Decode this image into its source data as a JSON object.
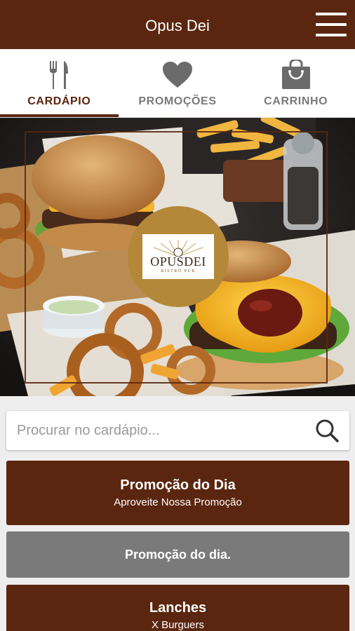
{
  "header": {
    "title": "Opus Dei",
    "menu_icon": "hamburger-menu-icon"
  },
  "tabs": [
    {
      "label": "CARDÁPIO",
      "icon": "fork-knife-icon",
      "active": true
    },
    {
      "label": "PROMOÇÕES",
      "icon": "heart-icon",
      "active": false
    },
    {
      "label": "CARRINHO",
      "icon": "shopping-bag-icon",
      "active": false
    }
  ],
  "hero": {
    "logo_name": "OPUSDEI",
    "logo_subtitle": "BISTRÔ PUB"
  },
  "search": {
    "placeholder": "Procurar no cardápio...",
    "icon": "search-icon"
  },
  "categories": [
    {
      "title": "Promoção do Dia",
      "subtitle": "Aproveite Nossa Promoção",
      "style": "brown"
    },
    {
      "title": "Promoção do dia.",
      "subtitle": "",
      "style": "gray"
    },
    {
      "title": "Lanches",
      "subtitle": "X Burguers",
      "style": "brown"
    }
  ],
  "colors": {
    "primary": "#5b260f",
    "inactive_tab": "#7a7a7a",
    "logo_gold": "#b38838",
    "gray_card": "#7a7a7a"
  }
}
